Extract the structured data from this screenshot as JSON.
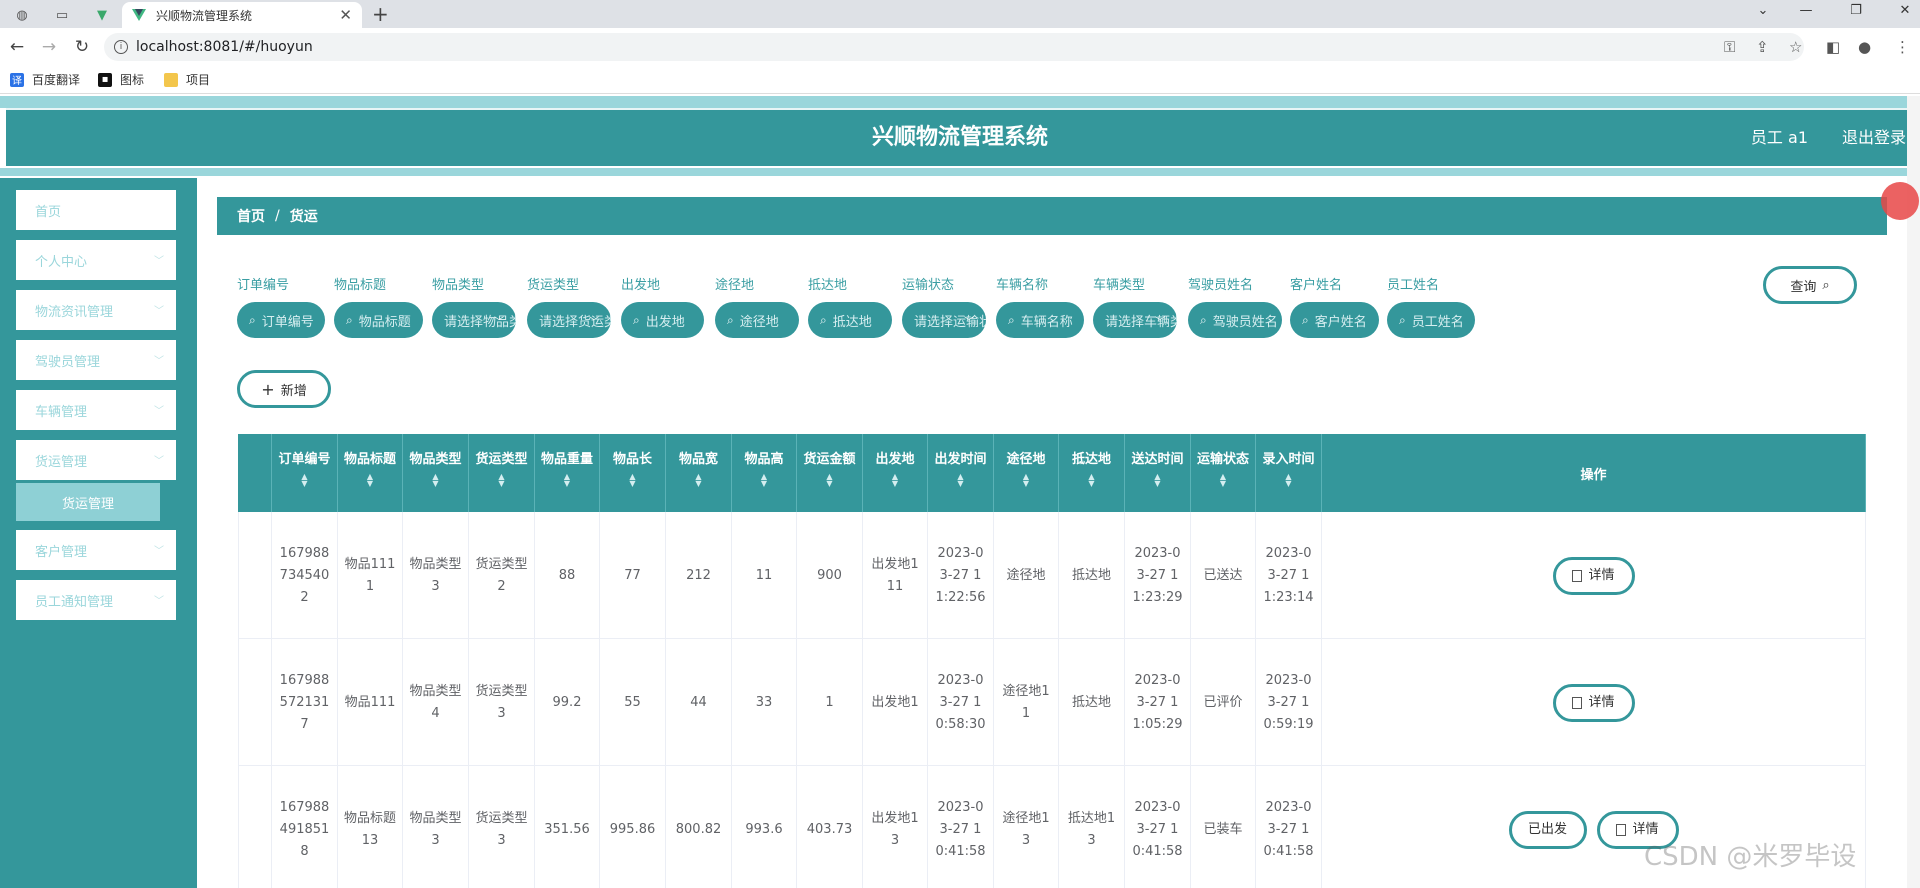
{
  "browser": {
    "tab_title": "兴顺物流管理系统",
    "url": "localhost:8081/#/huoyun",
    "bookmarks": [
      {
        "label": "百度翻译"
      },
      {
        "label": "图标"
      },
      {
        "label": "项目"
      }
    ]
  },
  "header": {
    "title": "兴顺物流管理系统",
    "user": "员工 a1",
    "logout": "退出登录"
  },
  "sidebar": {
    "items": [
      {
        "label": "首页"
      },
      {
        "label": "个人中心"
      },
      {
        "label": "物流资讯管理"
      },
      {
        "label": "驾驶员管理"
      },
      {
        "label": "车辆管理"
      },
      {
        "label": "货运管理"
      },
      {
        "label": "客户管理"
      },
      {
        "label": "员工通知管理"
      }
    ],
    "submenu": {
      "label": "货运管理"
    }
  },
  "breadcrumb": {
    "home": "首页",
    "separator": "/",
    "current": "货运"
  },
  "filters": [
    {
      "label": "订单编号",
      "placeholder": "订单编号"
    },
    {
      "label": "物品标题",
      "placeholder": "物品标题"
    },
    {
      "label": "物品类型",
      "placeholder": "请选择物品类型"
    },
    {
      "label": "货运类型",
      "placeholder": "请选择货运类型"
    },
    {
      "label": "出发地",
      "placeholder": "出发地"
    },
    {
      "label": "途径地",
      "placeholder": "途径地"
    },
    {
      "label": "抵达地",
      "placeholder": "抵达地"
    },
    {
      "label": "运输状态",
      "placeholder": "请选择运输状态"
    },
    {
      "label": "车辆名称",
      "placeholder": "车辆名称"
    },
    {
      "label": "车辆类型",
      "placeholder": "请选择车辆类型"
    },
    {
      "label": "驾驶员姓名",
      "placeholder": "驾驶员姓名"
    },
    {
      "label": "客户姓名",
      "placeholder": "客户姓名"
    },
    {
      "label": "员工姓名",
      "placeholder": "员工姓名"
    }
  ],
  "buttons": {
    "query": "查询",
    "add": "新增",
    "detail": "详情",
    "depart": "已出发"
  },
  "table": {
    "columns": [
      "订单编号",
      "物品标题",
      "物品类型",
      "货运类型",
      "物品重量",
      "物品长",
      "物品宽",
      "物品高",
      "货运金额",
      "出发地",
      "出发时间",
      "途径地",
      "抵达地",
      "送达时间",
      "运输状态",
      "录入时间"
    ],
    "ops_header": "操作",
    "rows": [
      {
        "cells": [
          "1679887345402",
          "物品1111",
          "物品类型3",
          "货运类型2",
          "88",
          "77",
          "212",
          "11",
          "900",
          "出发地111",
          "2023-03-27 11:22:56",
          "途径地",
          "抵达地",
          "2023-03-27 11:23:29",
          "已送达",
          "2023-03-27 11:23:14"
        ],
        "depart": false
      },
      {
        "cells": [
          "1679885721317",
          "物品111",
          "物品类型4",
          "货运类型3",
          "99.2",
          "55",
          "44",
          "33",
          "1",
          "出发地1",
          "2023-03-27 10:58:30",
          "途径地11",
          "抵达地",
          "2023-03-27 11:05:29",
          "已评价",
          "2023-03-27 10:59:19"
        ],
        "depart": false
      },
      {
        "cells": [
          "1679884918518",
          "物品标题13",
          "物品类型3",
          "货运类型3",
          "351.56",
          "995.86",
          "800.82",
          "993.6",
          "403.73",
          "出发地13",
          "2023-03-27 10:41:58",
          "途径地13",
          "抵达地13",
          "2023-03-27 10:41:58",
          "已装车",
          "2023-03-27 10:41:58"
        ],
        "depart": true
      }
    ]
  },
  "watermark": "CSDN @米罗毕设"
}
